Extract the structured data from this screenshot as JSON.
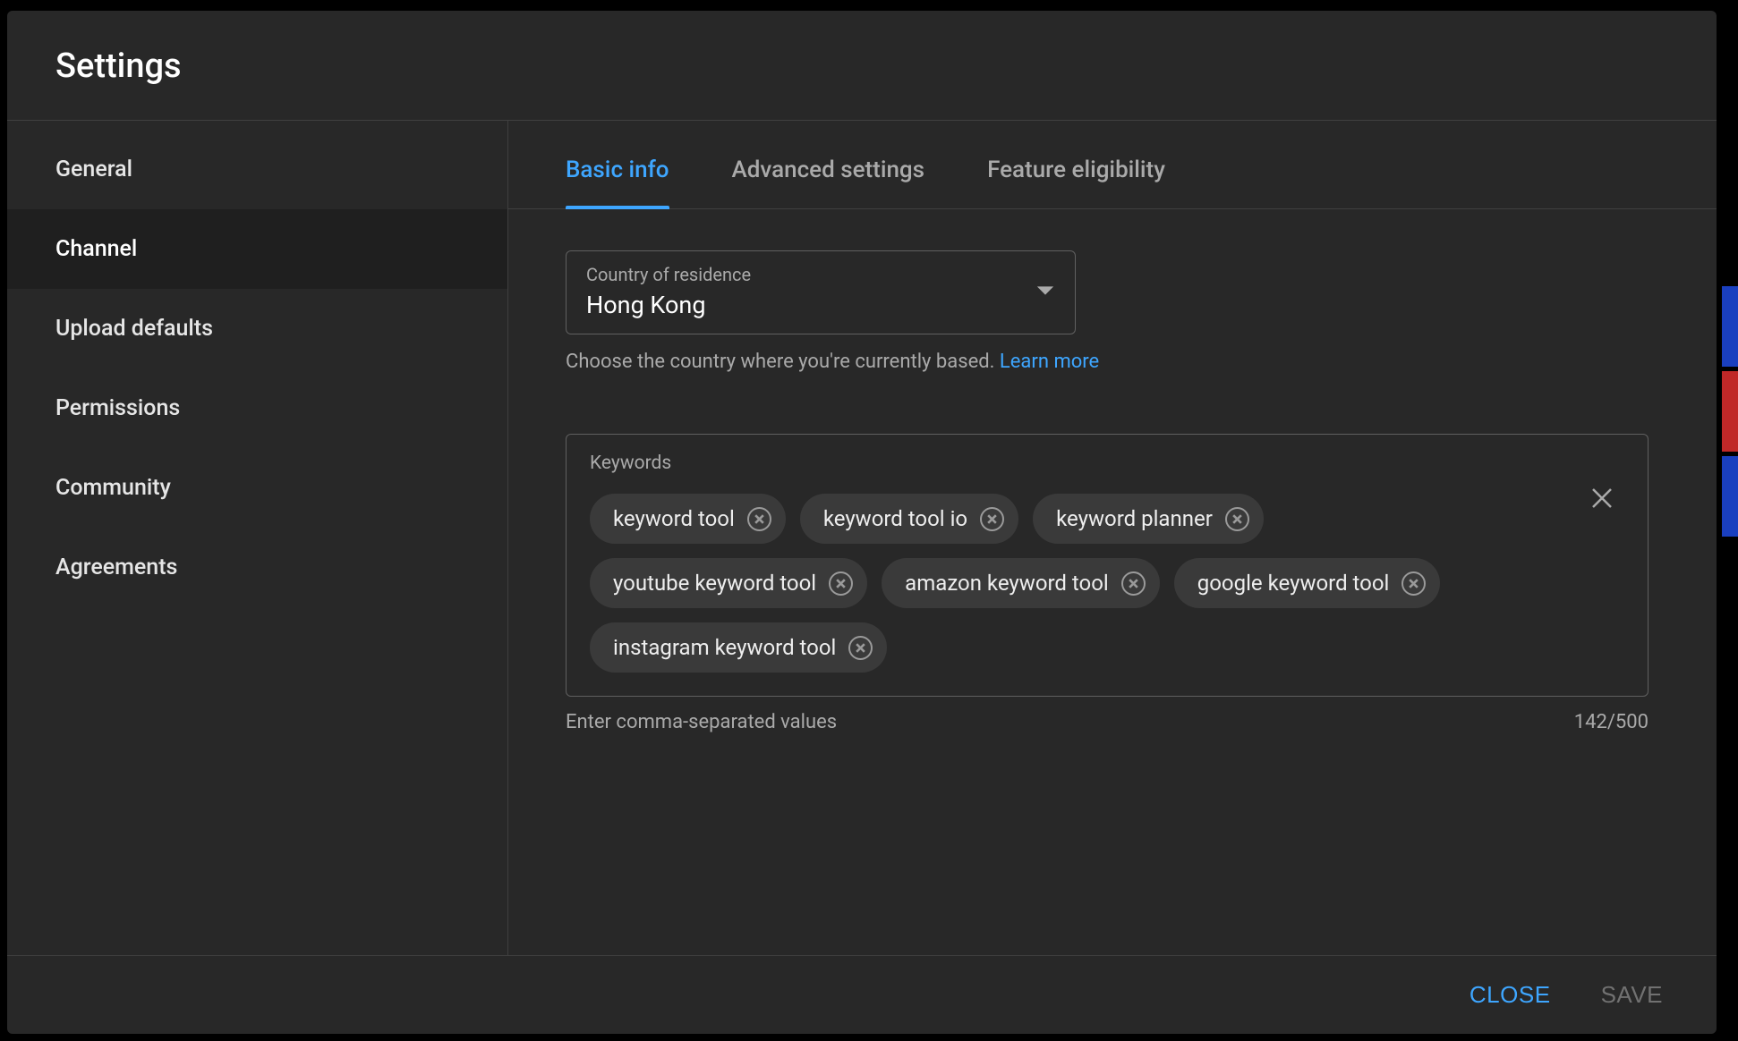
{
  "dialog": {
    "title": "Settings"
  },
  "sidebar": {
    "items": [
      {
        "label": "General"
      },
      {
        "label": "Channel"
      },
      {
        "label": "Upload defaults"
      },
      {
        "label": "Permissions"
      },
      {
        "label": "Community"
      },
      {
        "label": "Agreements"
      }
    ],
    "active_index": 1
  },
  "tabs": {
    "items": [
      {
        "label": "Basic info"
      },
      {
        "label": "Advanced settings"
      },
      {
        "label": "Feature eligibility"
      }
    ],
    "active_index": 0
  },
  "country": {
    "label": "Country of residence",
    "value": "Hong Kong",
    "helper": "Choose the country where you're currently based. ",
    "learn_more": "Learn more"
  },
  "keywords": {
    "label": "Keywords",
    "chips": [
      "keyword tool",
      "keyword tool io",
      "keyword planner",
      "youtube keyword tool",
      "amazon keyword tool",
      "google keyword tool",
      "instagram keyword tool"
    ],
    "helper": "Enter comma-separated values",
    "counter": "142/500"
  },
  "footer": {
    "close": "CLOSE",
    "save": "SAVE"
  }
}
